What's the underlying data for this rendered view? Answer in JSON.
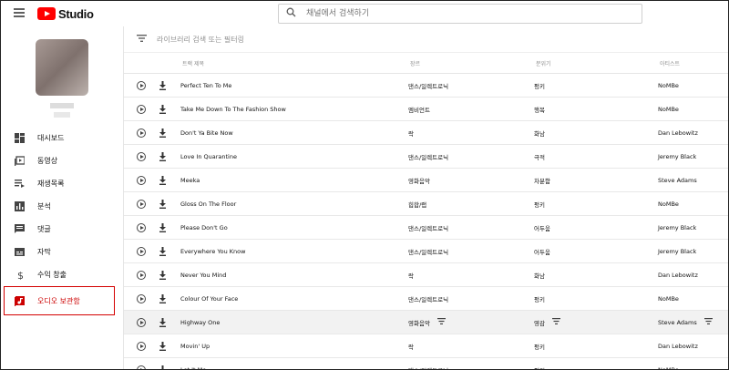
{
  "app": {
    "brand": "Studio",
    "brand_color": "#ff0000"
  },
  "search": {
    "placeholder": "채널에서 검색하기"
  },
  "sidebar": {
    "items": [
      {
        "label": "대시보드",
        "icon": "dashboard-icon"
      },
      {
        "label": "동영상",
        "icon": "video-icon"
      },
      {
        "label": "재생목록",
        "icon": "playlist-icon"
      },
      {
        "label": "분석",
        "icon": "analytics-icon"
      },
      {
        "label": "댓글",
        "icon": "comments-icon"
      },
      {
        "label": "자막",
        "icon": "subtitles-icon"
      },
      {
        "label": "수익 창출",
        "icon": "dollar-icon"
      },
      {
        "label": "오디오 보관함",
        "icon": "audio-library-icon",
        "active": true
      }
    ],
    "active_color": "#cc0000"
  },
  "library": {
    "filter_placeholder": "라이브러리 검색 또는 필터링",
    "columns": {
      "title": "트랙 제목",
      "genre": "장르",
      "mood": "분위기",
      "artist": "아티스트"
    },
    "tracks": [
      {
        "title": "Perfect Ten To Me",
        "genre": "댄스/일렉트로닉",
        "mood": "펑키",
        "artist": "NoMBe"
      },
      {
        "title": "Take Me Down To The Fashion Show",
        "genre": "엠비언트",
        "mood": "행복",
        "artist": "NoMBe"
      },
      {
        "title": "Don't Ya Bite Now",
        "genre": "락",
        "mood": "화남",
        "artist": "Dan Lebowitz"
      },
      {
        "title": "Love In Quarantine",
        "genre": "댄스/일렉트로닉",
        "mood": "극적",
        "artist": "Jeremy Black"
      },
      {
        "title": "Meeka",
        "genre": "영화음악",
        "mood": "차분함",
        "artist": "Steve Adams"
      },
      {
        "title": "Gloss On The Floor",
        "genre": "힙합/랩",
        "mood": "펑키",
        "artist": "NoMBe"
      },
      {
        "title": "Please Don't Go",
        "genre": "댄스/일렉트로닉",
        "mood": "어두움",
        "artist": "Jeremy Black"
      },
      {
        "title": "Everywhere You Know",
        "genre": "댄스/일렉트로닉",
        "mood": "어두움",
        "artist": "Jeremy Black"
      },
      {
        "title": "Never You Mind",
        "genre": "락",
        "mood": "화남",
        "artist": "Dan Lebowitz"
      },
      {
        "title": "Colour Of Your Face",
        "genre": "댄스/일렉트로닉",
        "mood": "펑키",
        "artist": "NoMBe"
      },
      {
        "title": "Highway One",
        "genre": "영화음악",
        "mood": "영감",
        "artist": "Steve Adams",
        "highlighted": true
      },
      {
        "title": "Movin' Up",
        "genre": "락",
        "mood": "펑키",
        "artist": "Dan Lebowitz"
      },
      {
        "title": "Let It Me",
        "genre": "댄스/일렉트로닉",
        "mood": "펑키",
        "artist": "NoMBe"
      }
    ]
  }
}
